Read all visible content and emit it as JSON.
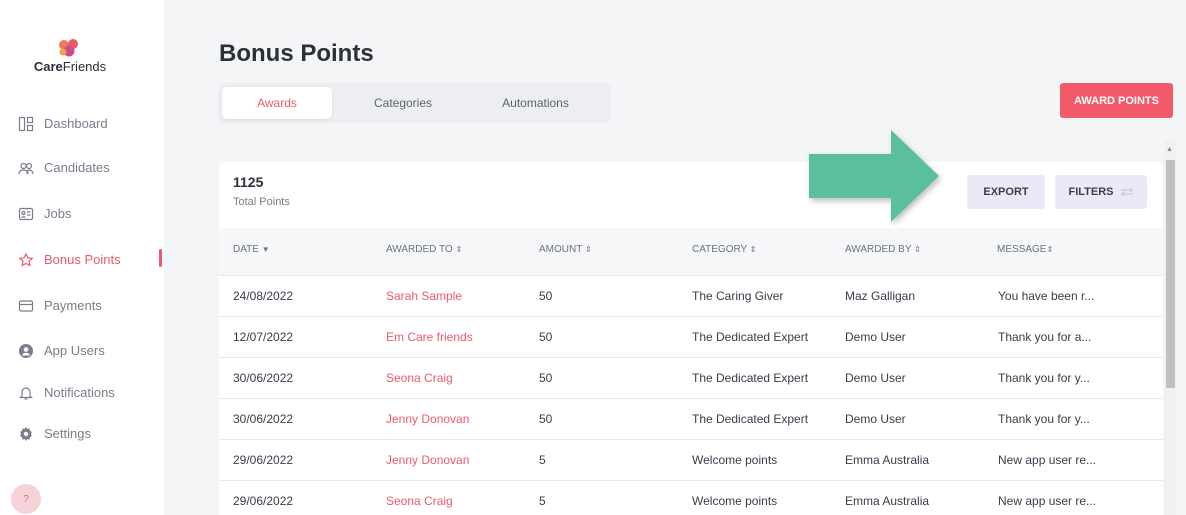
{
  "brand": {
    "name_bold": "Care",
    "name_regular": "Friends"
  },
  "sidebar": {
    "items": [
      {
        "label": "Dashboard",
        "icon": "dashboard-icon"
      },
      {
        "label": "Candidates",
        "icon": "people-icon"
      },
      {
        "label": "Jobs",
        "icon": "id-card-icon"
      },
      {
        "label": "Bonus Points",
        "icon": "star-icon",
        "active": true
      },
      {
        "label": "Payments",
        "icon": "credit-card-icon"
      },
      {
        "label": "App Users",
        "icon": "user-circle-icon"
      },
      {
        "label": "Notifications",
        "icon": "bell-icon"
      },
      {
        "label": "Settings",
        "icon": "gear-icon"
      }
    ],
    "help": "?"
  },
  "page": {
    "title": "Bonus Points"
  },
  "tabs": [
    {
      "label": "Awards",
      "active": true
    },
    {
      "label": "Categories"
    },
    {
      "label": "Automations"
    }
  ],
  "actions": {
    "award_points": "AWARD POINTS",
    "export": "EXPORT",
    "filters": "FILTERS"
  },
  "summary": {
    "total_value": "1125",
    "total_label": "Total Points"
  },
  "table": {
    "columns": [
      "DATE",
      "AWARDED TO",
      "AMOUNT",
      "CATEGORY",
      "AWARDED BY",
      "MESSAGE"
    ],
    "rows": [
      [
        "24/08/2022",
        "Sarah Sample",
        "50",
        "The Caring Giver",
        "Maz Galligan",
        "You have been r..."
      ],
      [
        "12/07/2022",
        "Em Care friends",
        "50",
        "The Dedicated Expert",
        "Demo User",
        "Thank you for a..."
      ],
      [
        "30/06/2022",
        "Seona Craig",
        "50",
        "The Dedicated Expert",
        "Demo User",
        "Thank you for y..."
      ],
      [
        "30/06/2022",
        "Jenny Donovan",
        "50",
        "The Dedicated Expert",
        "Demo User",
        "Thank you for y..."
      ],
      [
        "29/06/2022",
        "Jenny Donovan",
        "5",
        "Welcome points",
        "Emma Australia",
        "New app user re..."
      ],
      [
        "29/06/2022",
        "Seona Craig",
        "5",
        "Welcome points",
        "Emma Australia",
        "New app user re..."
      ]
    ]
  },
  "colors": {
    "accent": "#f25a69",
    "arrow": "#5cbf9c",
    "light_button": "#ebe9f6"
  }
}
